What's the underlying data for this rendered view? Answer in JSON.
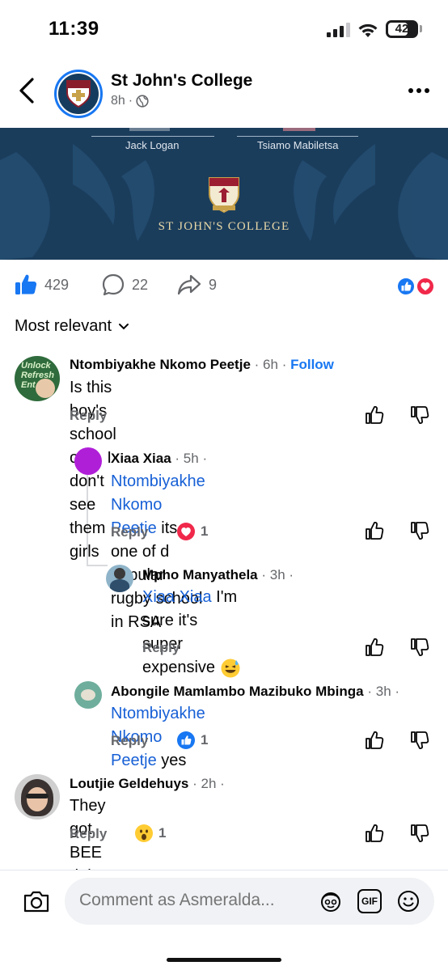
{
  "status_bar": {
    "time": "11:39",
    "battery": "42"
  },
  "header": {
    "page_name": "St John's College",
    "post_age": "8h",
    "audience_icon": "globe-icon"
  },
  "banner": {
    "names": [
      "Jack Logan",
      "Tsiamo Mabiletsa"
    ],
    "brand": "ST JOHN'S COLLEGE"
  },
  "engagement": {
    "likes": "429",
    "comments": "22",
    "shares": "9",
    "reactions": [
      "like",
      "love"
    ]
  },
  "sort": {
    "label": "Most relevant"
  },
  "comments": [
    {
      "author": "Ntombiyakhe Nkomo Peetje",
      "time": "6h",
      "follow": "Follow",
      "text": "Is this boy's school only. I don't see them girls",
      "reply": "Reply",
      "avatar_text": [
        "Unlock",
        "Refresh",
        "Ent"
      ]
    },
    {
      "author": "Xiaa Xiaa",
      "time": "5h",
      "mention": "Ntombiyakhe Nkomo Peetje",
      "text_line1": " its one of d",
      "text_line2": "popular rugby school in RSA",
      "reply": "Reply",
      "reaction_count": "1"
    },
    {
      "author": "Mpho Manyathela",
      "time": "3h",
      "mention": "Xiaa Xiaa",
      "text_line1": " I'm sure it's super",
      "text_line2": "expensive",
      "reply": "Reply"
    },
    {
      "author": "Abongile Mamlambo Mazibuko Mbinga",
      "time": "3h",
      "mention": "Ntombiyakhe Nkomo Peetje",
      "text": " yes",
      "reply": "Reply",
      "reaction_count": "1"
    },
    {
      "author": "Loutjie Geldehuys",
      "time": "2h",
      "text": "They got BEE right",
      "reply": "Reply",
      "reaction_count": "1"
    }
  ],
  "composer": {
    "placeholder": "Comment as Asmeralda...",
    "gif_label": "GIF"
  },
  "colors": {
    "accent": "#1877f2",
    "banner": "#1b3d5c",
    "text": "#050505",
    "muted": "#65676b"
  }
}
